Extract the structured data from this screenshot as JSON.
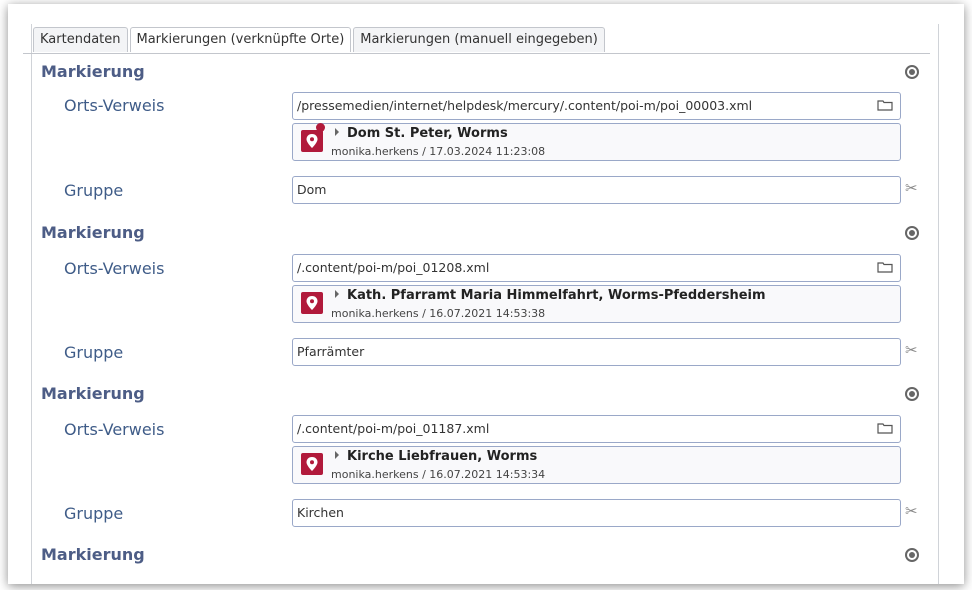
{
  "tabs": [
    "Kartendaten",
    "Markierungen (verknüpfte Orte)",
    "Markierungen (manuell eingegeben)"
  ],
  "labels": {
    "markierung": "Markierung",
    "orts_verweis": "Orts-Verweis",
    "gruppe": "Gruppe"
  },
  "markers": [
    {
      "path": "/pressemedien/internet/helpdesk/mercury/.content/poi-m/poi_00003.xml",
      "poi_title": "Dom St. Peter, Worms",
      "poi_meta": "monika.herkens / 17.03.2024 11:23:08",
      "gruppe": "Dom"
    },
    {
      "path": "/.content/poi-m/poi_01208.xml",
      "poi_title": "Kath. Pfarramt Maria Himmelfahrt, Worms-Pfeddersheim",
      "poi_meta": "monika.herkens / 16.07.2021 14:53:38",
      "gruppe": "Pfarrämter"
    },
    {
      "path": "/.content/poi-m/poi_01187.xml",
      "poi_title": "Kirche Liebfrauen, Worms",
      "poi_meta": "monika.herkens / 16.07.2021 14:53:34",
      "gruppe": "Kirchen"
    }
  ],
  "icons": {
    "remove": "circle-dot-icon",
    "browse": "folder-icon",
    "pin": "map-pin-icon",
    "cut": "scissors-icon"
  },
  "colors": {
    "label": "#4d5d86",
    "pin": "#b11a3b",
    "border": "#9aa8c8"
  }
}
